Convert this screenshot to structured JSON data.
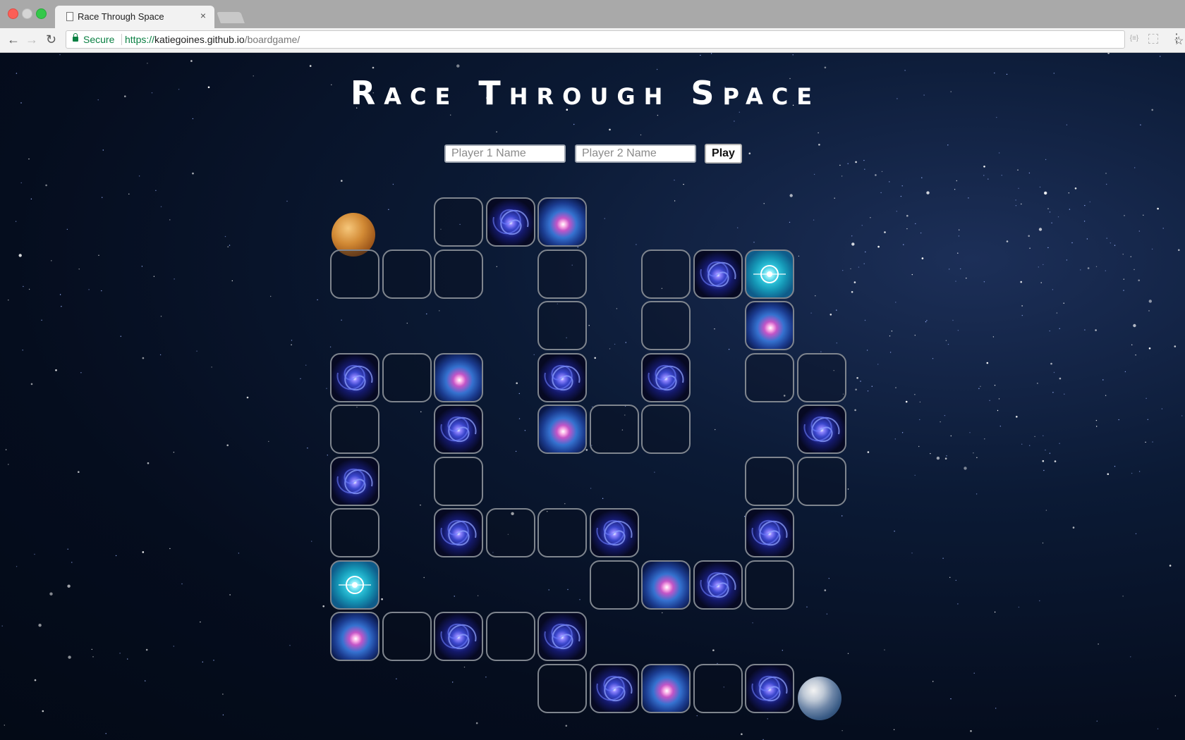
{
  "browser": {
    "tab_title": "Race Through Space",
    "tab_close": "×",
    "secure_label": "Secure",
    "url_scheme": "https://",
    "url_host": "katiegoines.github.io",
    "url_path": "/boardgame/",
    "back_icon": "arrow-left-icon",
    "forward_icon": "arrow-right-icon",
    "reload_icon": "reload-icon",
    "star_icon": "star-icon",
    "menu_icon": "more-vert-icon",
    "ext1_label": "{≡}"
  },
  "page": {
    "title": "Race Through Space",
    "player1_placeholder": "Player 1 Name",
    "player2_placeholder": "Player 2 Name",
    "play_label": "Play",
    "start_planet": "venus",
    "end_planet": "earth"
  },
  "board": {
    "tile_types": [
      "empty",
      "galaxy",
      "nebula",
      "portal"
    ],
    "rows": [
      [
        "",
        "",
        "empty",
        "galaxy",
        "nebula",
        "",
        "",
        "",
        "",
        ""
      ],
      [
        "empty",
        "empty",
        "empty",
        "",
        "empty",
        "",
        "empty",
        "galaxy",
        "portal",
        ""
      ],
      [
        "",
        "",
        "",
        "",
        "empty",
        "",
        "empty",
        "",
        "nebula",
        ""
      ],
      [
        "galaxy",
        "empty",
        "nebula",
        "",
        "galaxy",
        "",
        "galaxy",
        "",
        "empty",
        "empty"
      ],
      [
        "empty",
        "",
        "galaxy",
        "",
        "nebula",
        "empty",
        "empty",
        "",
        "",
        "galaxy"
      ],
      [
        "galaxy",
        "",
        "empty",
        "",
        "",
        "",
        "",
        "",
        "empty",
        "empty"
      ],
      [
        "empty",
        "",
        "galaxy",
        "empty",
        "empty",
        "galaxy",
        "",
        "",
        "galaxy",
        ""
      ],
      [
        "portal",
        "",
        "",
        "",
        "",
        "empty",
        "nebula",
        "galaxy",
        "empty",
        ""
      ],
      [
        "nebula",
        "empty",
        "galaxy",
        "empty",
        "galaxy",
        "",
        "",
        "",
        "",
        ""
      ],
      [
        "",
        "",
        "",
        "",
        "empty",
        "galaxy",
        "nebula",
        "empty",
        "galaxy",
        ""
      ]
    ]
  },
  "colors": {
    "background": "#050d1e",
    "galaxy": "#3a46cc",
    "nebula": "#c355c7",
    "portal": "#2fc6dc",
    "tile_border": "#7f858e"
  }
}
